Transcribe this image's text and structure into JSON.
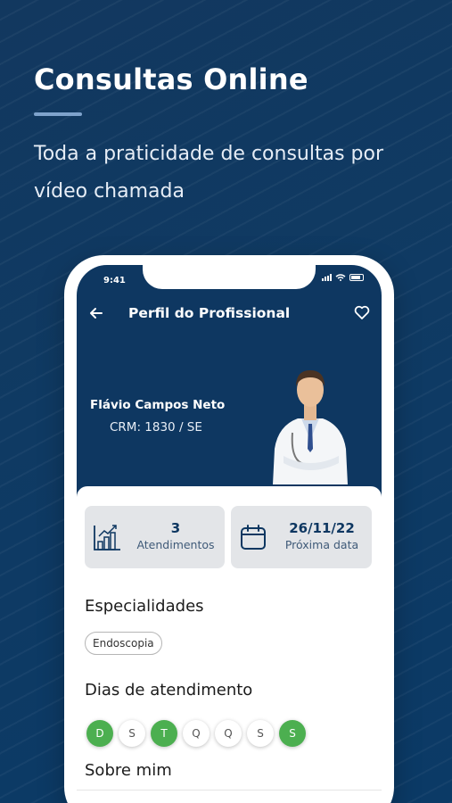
{
  "promo": {
    "title": "Consultas Online",
    "subtitle": "Toda a praticidade de consultas por vídeo chamada"
  },
  "status_bar": {
    "time": "9:41"
  },
  "header": {
    "title": "Perfil do Profissional"
  },
  "doctor": {
    "name": "Flávio Campos Neto",
    "crm": "CRM: 1830 / SE"
  },
  "stats": [
    {
      "value": "3",
      "label": "Atendimentos",
      "icon": "bar-chart-icon"
    },
    {
      "value": "26/11/22",
      "label": "Próxima data",
      "icon": "calendar-icon"
    }
  ],
  "specialties": {
    "title": "Especialidades",
    "items": [
      "Endoscopia"
    ]
  },
  "days": {
    "title": "Dias de atendimento",
    "items": [
      {
        "label": "D",
        "active": true
      },
      {
        "label": "S",
        "active": false
      },
      {
        "label": "T",
        "active": true
      },
      {
        "label": "Q",
        "active": false
      },
      {
        "label": "Q",
        "active": false
      },
      {
        "label": "S",
        "active": false
      },
      {
        "label": "S",
        "active": true
      }
    ]
  },
  "about": {
    "title": "Sobre mim"
  },
  "colors": {
    "primary": "#0e3761",
    "active_day": "#4caf50"
  }
}
